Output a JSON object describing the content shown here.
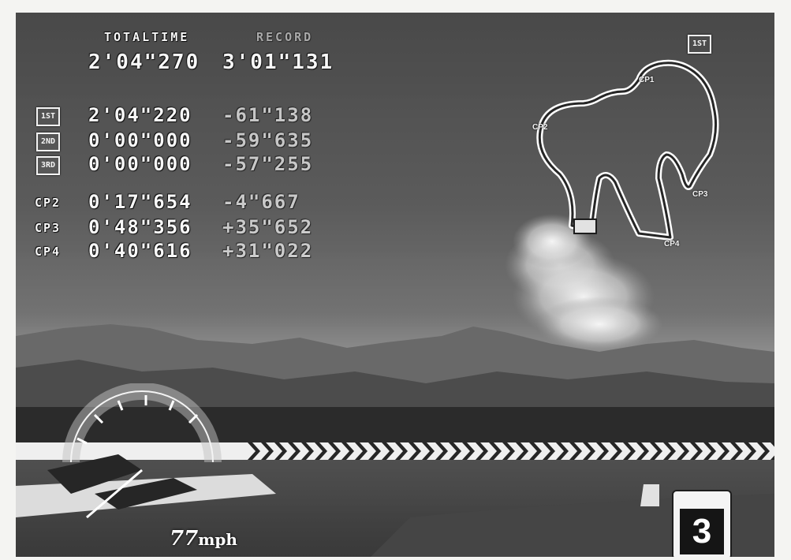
{
  "hud": {
    "total_time_label": "TOTALTIME",
    "record_label": "RECORD",
    "total_time_value": "2'04\"270",
    "record_value": "3'01\"131",
    "laps": [
      {
        "label": "1ST",
        "time": "2'04\"220",
        "diff": "-61\"138"
      },
      {
        "label": "2ND",
        "time": "0'00\"000",
        "diff": "-59\"635"
      },
      {
        "label": "3RD",
        "time": "0'00\"000",
        "diff": "-57\"255"
      }
    ],
    "checkpoints": [
      {
        "label": "CP2",
        "time": "0'17\"654",
        "diff": "-4\"667"
      },
      {
        "label": "CP3",
        "time": "0'48\"356",
        "diff": "+35\"652"
      },
      {
        "label": "CP4",
        "time": "0'40\"616",
        "diff": "+31\"022"
      }
    ],
    "map_badge": "1ST",
    "map_checkpoints": [
      "CP1",
      "CP2",
      "CP3",
      "CP4"
    ],
    "speed_value": "77",
    "speed_unit": "mph",
    "gear": "3"
  }
}
